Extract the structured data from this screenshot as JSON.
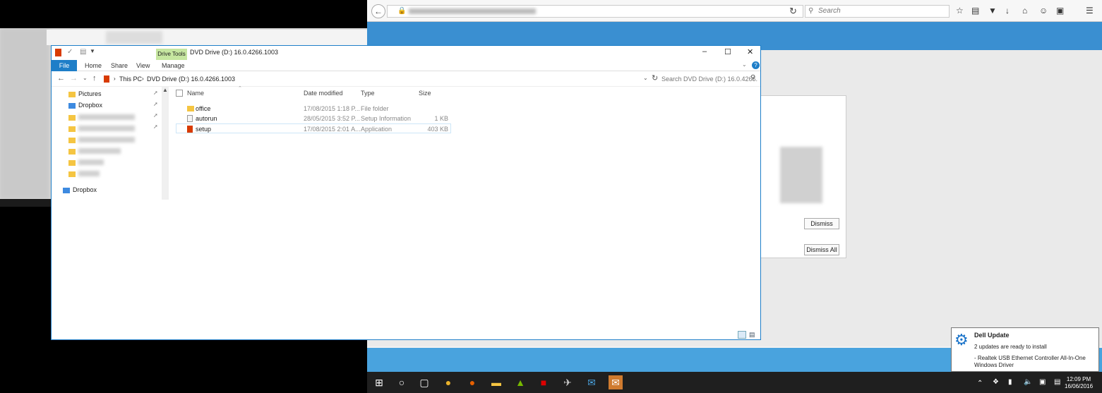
{
  "firefox": {
    "search_placeholder": "Search"
  },
  "dialog": {
    "dismiss_label": "Dismiss",
    "dismiss_all_label": "Dismiss All"
  },
  "explorer": {
    "title": "DVD Drive (D:) 16.0.4266.1003",
    "context_tab": "Drive Tools",
    "tabs": [
      "File",
      "Home",
      "Share",
      "View",
      "Manage"
    ],
    "breadcrumb": [
      "This PC",
      "DVD Drive (D:) 16.0.4266.1003"
    ],
    "search_placeholder": "Search DVD Drive (D:) 16.0.4266...",
    "nav": [
      "Pictures",
      "Dropbox",
      "Dropbox"
    ],
    "columns": [
      "Name",
      "Date modified",
      "Type",
      "Size"
    ],
    "files": [
      {
        "name": "office",
        "date": "17/08/2015 1:18 P...",
        "type": "File folder",
        "size": ""
      },
      {
        "name": "autorun",
        "date": "28/05/2015 3:52 P...",
        "type": "Setup Information",
        "size": "1 KB"
      },
      {
        "name": "setup",
        "date": "17/08/2015 2:01 A...",
        "type": "Application",
        "size": "403 KB"
      }
    ]
  },
  "toast": {
    "title": "Dell Update",
    "line1": "2 updates are ready to install",
    "line2": "- Realtek USB Ethernet Controller All-In-One",
    "line3": "Windows Driver"
  },
  "clock": {
    "time": "12:09 PM",
    "date": "16/06/2016"
  },
  "colors": {
    "accent": "#1e7ec8",
    "drive_tools": "#c6e6a0",
    "firefox_banner": "#3a8fd1"
  }
}
